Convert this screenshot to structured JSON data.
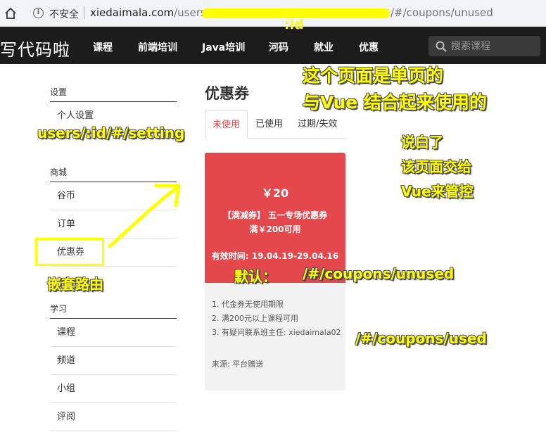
{
  "browser": {
    "insecure_label": "不安全",
    "url_domain": "xiedaimala.com",
    "url_path_visible": "/users/",
    "url_partial": "0",
    "url_tail": "/#/coupons/unused"
  },
  "header": {
    "logo": "写代码啦",
    "nav": [
      "课程",
      "前端培训",
      "Java培训",
      "河码",
      "就业",
      "优惠"
    ],
    "search_placeholder": "搜索课程"
  },
  "sidebar": {
    "sections": [
      {
        "title": "设置",
        "items": [
          "个人设置"
        ]
      },
      {
        "title": "商城",
        "items": [
          "谷币",
          "订单",
          "优惠券"
        ]
      },
      {
        "title": "学习",
        "items": [
          "课程",
          "频道",
          "小组",
          "评阅"
        ]
      }
    ]
  },
  "main": {
    "title": "优惠券",
    "tabs": [
      "未使用",
      "已使用",
      "过期/失效"
    ],
    "active_tab": 0,
    "coupon": {
      "amount": "￥20",
      "name": "【满减券】 五一专场优惠券",
      "min_spend": "满￥200可用",
      "valid": "有效时间: 19.04.19-29.04.16",
      "rules": [
        "1. 代金券无使用期限",
        "2. 满200元以上课程可用",
        "3. 有疑问联系班主任: xiedaimala02"
      ],
      "source": "来源: 平台赠送"
    }
  },
  "annotations": {
    "id_note": ":id",
    "single_page_1": "这个页面是单页的",
    "single_page_2": "与Vue 结合起来使用的",
    "setting_route": "users/:id/#/setting",
    "vue_1": "说白了",
    "vue_2": "该页面交给",
    "vue_3": "Vue来管控",
    "nested_route": "嵌套路由",
    "default_label": "默认：",
    "unused_route": "/#/coupons/unused",
    "used_route": "/#/coupons/used"
  },
  "colors": {
    "header_bg": "#1c1c1c",
    "accent_red": "#e4484d",
    "annotation_yellow": "#ffff00"
  }
}
